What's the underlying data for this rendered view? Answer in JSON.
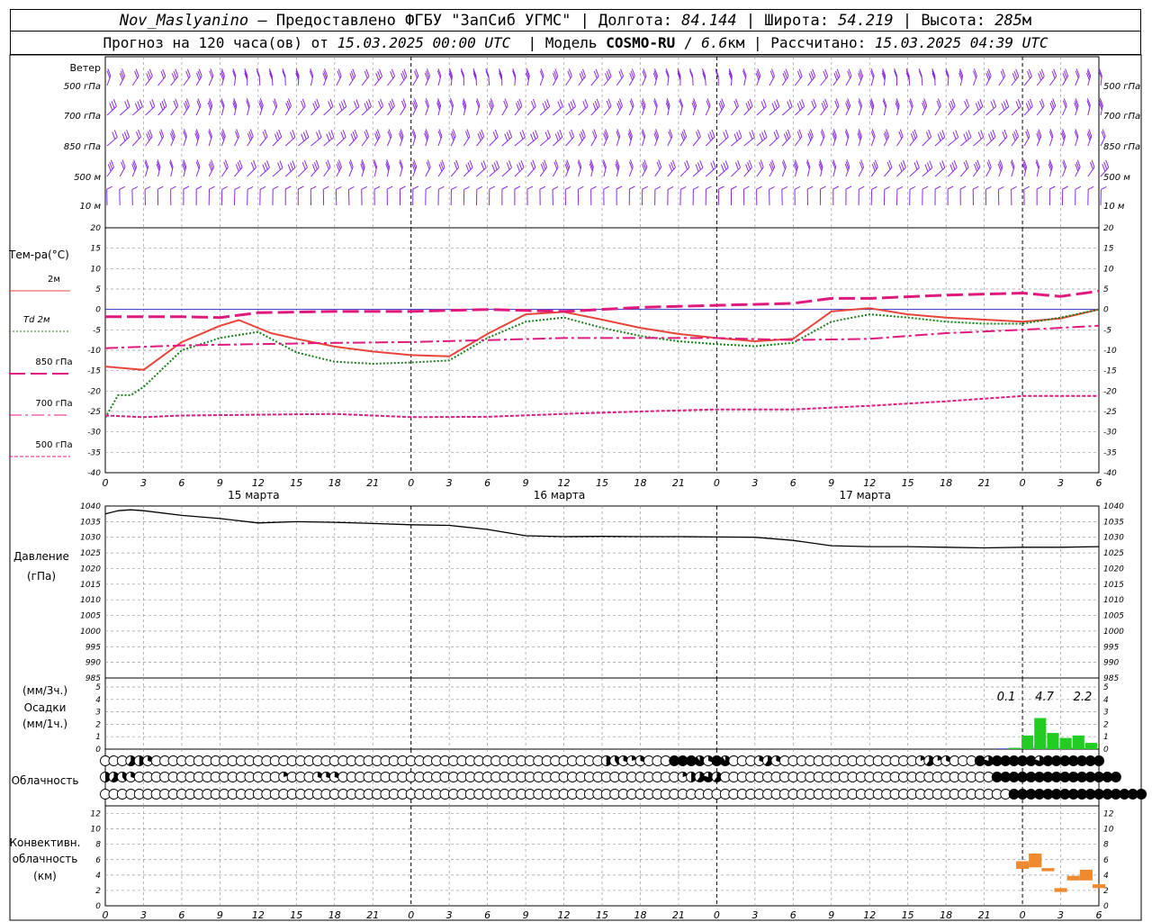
{
  "header": {
    "station": "Nov_Maslyanino",
    "sep1": " – Предоставлено ФГБУ \"ЗапСиб УГМС\" | Долгота: ",
    "lon": "84.144",
    "sep2": " | Широта: ",
    "lat": "54.219",
    "sep3": " | Высота: ",
    "alt": "285",
    "alt_unit": "м",
    "fc_prefix": "Прогноз на 120 часа(ов) от ",
    "fc_start": "15.03.2025 00:00 UTC",
    "model_prefix": "  | Модель ",
    "model": "COSMO-RU",
    "model_sep": " / ",
    "res": "6.6",
    "res_unit": "км",
    "calc_prefix": " | Рассчитано: ",
    "calc_time": "15.03.2025 04:39 UTC"
  },
  "colors": {
    "t2m": "#e8443a",
    "td2m": "#1a7f1a",
    "t850": "#e0197d",
    "t700": "#e0197d",
    "t500": "#e0197d",
    "wind": "#8a2be2",
    "zero_line": "#3333cc",
    "pressure": "#000000",
    "precip_3h": "#22cc22",
    "precip_1h": "#2233cc",
    "convective": "#f08a30",
    "grid": "#999999"
  },
  "x_axis": {
    "hours": [
      0,
      3,
      6,
      9,
      12,
      15,
      18,
      21,
      0,
      3,
      6,
      9,
      12,
      15,
      18,
      21,
      0,
      3,
      6,
      9,
      12,
      15,
      18,
      21,
      0,
      3,
      6
    ],
    "day_labels": [
      {
        "label": "15 марта",
        "hour": 12
      },
      {
        "label": "16 марта",
        "hour": 36
      },
      {
        "label": "17 марта",
        "hour": 60
      }
    ],
    "range": [
      0,
      78
    ]
  },
  "chart_data": [
    {
      "type": "wind_barbs",
      "title": "Ветер",
      "levels": [
        "500 гПа",
        "700 гПа",
        "850 гПа",
        "500 м",
        "10  м"
      ],
      "spacing_hours": 1
    },
    {
      "type": "line",
      "ylabel": "Тем-ра(°C)",
      "ylim": [
        -40,
        20
      ],
      "yticks": [
        20,
        15,
        10,
        5,
        0,
        -5,
        -10,
        -15,
        -20,
        -25,
        -30,
        -35,
        -40
      ],
      "series": [
        {
          "name": "2м",
          "key": "t2m",
          "dash": "",
          "x": [
            0,
            3,
            6,
            9,
            10.5,
            13,
            15,
            18,
            21,
            24,
            27,
            30,
            33,
            36,
            39,
            42,
            45,
            48,
            51,
            54,
            57,
            60,
            63,
            66,
            69,
            72,
            75,
            78
          ],
          "y": [
            -14,
            -14.8,
            -8,
            -4,
            -2.6,
            -5.8,
            -7.2,
            -9.1,
            -10.3,
            -11.2,
            -11.5,
            -6,
            -1.2,
            -0.6,
            -2.5,
            -4.5,
            -6,
            -7,
            -7.8,
            -7.2,
            -0.5,
            0.3,
            -1.2,
            -2,
            -2.5,
            -3,
            -2.2,
            0
          ]
        },
        {
          "name": "Td 2м",
          "key": "td2m",
          "dash": "2,2",
          "x": [
            0,
            1,
            2,
            3,
            6,
            9,
            12,
            15,
            18,
            21,
            24,
            27,
            30,
            33,
            36,
            39,
            42,
            45,
            48,
            51,
            54,
            57,
            60,
            63,
            66,
            69,
            72,
            75,
            78
          ],
          "y": [
            -26.5,
            -21,
            -21,
            -19,
            -10,
            -7,
            -5.5,
            -10.5,
            -12.8,
            -13.3,
            -13,
            -12.5,
            -7,
            -3,
            -2,
            -4.5,
            -6.5,
            -7.8,
            -8.5,
            -9,
            -8.2,
            -3,
            -1.2,
            -2,
            -3,
            -3.5,
            -3.5,
            -2,
            0
          ]
        },
        {
          "name": "850 гПа",
          "key": "t850",
          "dash": "18,6",
          "x": [
            0,
            6,
            9,
            12,
            18,
            24,
            30,
            36,
            42,
            48,
            54,
            57,
            60,
            66,
            72,
            75,
            78
          ],
          "y": [
            -1.8,
            -1.8,
            -2,
            -0.8,
            -0.5,
            -0.5,
            0,
            -0.5,
            0.5,
            1,
            1.5,
            2.7,
            2.7,
            3.5,
            4,
            3.2,
            4.5
          ]
        },
        {
          "name": "700 гПа",
          "key": "t700",
          "dash": "14,4,3,4",
          "x": [
            0,
            6,
            12,
            18,
            24,
            30,
            36,
            42,
            48,
            54,
            60,
            66,
            72,
            78
          ],
          "y": [
            -9.5,
            -8.8,
            -8.5,
            -8.2,
            -8,
            -7.5,
            -7,
            -7,
            -7,
            -7.5,
            -7.2,
            -5.8,
            -5,
            -4
          ]
        },
        {
          "name": "500 гПа",
          "key": "t500",
          "dash": "4,2",
          "x": [
            0,
            3,
            6,
            12,
            18,
            24,
            30,
            36,
            42,
            48,
            54,
            60,
            66,
            72,
            78
          ],
          "y": [
            -26,
            -26.4,
            -26,
            -25.8,
            -25.6,
            -26.4,
            -26.3,
            -25.6,
            -25,
            -24.5,
            -24.5,
            -23.6,
            -22.5,
            -21.2,
            -21.2
          ]
        }
      ]
    },
    {
      "type": "line",
      "ylabel": "Давление",
      "yunit": "(гПа)",
      "ylim": [
        985,
        1040
      ],
      "yticks": [
        1040,
        1035,
        1030,
        1025,
        1020,
        1015,
        1010,
        1005,
        1000,
        995,
        990,
        985
      ],
      "series": [
        {
          "key": "pressure",
          "x": [
            0,
            1,
            2,
            3,
            6,
            9,
            12,
            15,
            18,
            21,
            24,
            27,
            30,
            33,
            36,
            39,
            42,
            45,
            48,
            51,
            54,
            57,
            60,
            63,
            66,
            69,
            72,
            75,
            78
          ],
          "y": [
            1037.5,
            1038.5,
            1038.8,
            1038.5,
            1037,
            1036,
            1034.6,
            1035,
            1034.8,
            1034.4,
            1034,
            1033.8,
            1032.5,
            1030.5,
            1030.2,
            1030.3,
            1030.2,
            1030.2,
            1030.1,
            1030,
            1029,
            1027.3,
            1027,
            1027,
            1026.8,
            1026.6,
            1026.8,
            1026.8,
            1027
          ]
        }
      ]
    },
    {
      "type": "bar",
      "ylabel": "Осадки",
      "yunit_top": "(мм/3ч.)",
      "yunit_bottom": "(мм/1ч.)",
      "ylim": [
        0,
        5
      ],
      "yticks": [
        5,
        4,
        3,
        2,
        1,
        0
      ],
      "totals": [
        {
          "hour": 72,
          "label": "0.1"
        },
        {
          "hour": 75,
          "label": "4.7"
        },
        {
          "hour": 78,
          "label": "2.2"
        }
      ],
      "series": [
        {
          "name": "мм/1ч.",
          "key": "precip_1h",
          "x": [
            70,
            71,
            72,
            73,
            74,
            75,
            76,
            77
          ],
          "values": [
            0.05,
            0.1,
            0.2,
            0.3,
            0.15,
            0.2,
            0.15,
            0.1
          ]
        },
        {
          "name": "мм/3ч.",
          "key": "precip_3h",
          "x": [
            71,
            72,
            73,
            74,
            75,
            76,
            77
          ],
          "values": [
            0.1,
            1.1,
            2.5,
            1.3,
            0.9,
            1.1,
            0.5
          ]
        }
      ]
    },
    {
      "type": "table",
      "ylabel": "Облачность",
      "rows": [
        {
          "name": "high",
          "values": [
            0,
            0,
            0,
            0.6,
            0.5,
            0.3,
            0,
            0,
            0,
            0,
            0,
            0,
            0,
            0,
            0,
            0,
            0,
            0,
            0,
            0,
            0,
            0,
            0,
            0,
            0,
            0,
            0,
            0,
            0,
            0,
            0,
            0,
            0,
            0,
            0,
            0,
            0,
            0,
            0,
            0,
            0,
            0,
            0,
            0,
            0,
            0,
            0,
            0,
            0,
            0,
            0,
            0,
            0,
            0,
            0,
            0,
            0,
            0,
            0,
            0.5,
            0.4,
            0.3,
            0.2,
            0.3,
            0,
            0,
            0,
            1,
            1,
            1,
            0.9,
            0.3,
            1,
            0.9,
            0,
            0,
            0,
            0.3,
            0.6,
            0.3,
            0,
            0,
            0,
            0,
            0,
            0,
            0,
            0,
            0,
            0,
            0,
            0,
            0,
            0,
            0,
            0,
            0.2,
            0.6,
            0.2,
            0.3,
            0,
            0,
            0,
            1,
            0.8,
            1,
            1,
            1,
            1,
            1,
            0.8,
            1,
            1,
            1,
            1,
            1,
            1,
            1
          ]
        },
        {
          "name": "middle",
          "values": [
            0.5,
            0.6,
            0.4,
            0.3,
            0,
            0,
            0,
            0,
            0,
            0,
            0,
            0,
            0,
            0,
            0,
            0,
            0,
            0,
            0,
            0,
            0,
            0.2,
            0,
            0,
            0,
            0.3,
            0.3,
            0.3,
            0,
            0,
            0,
            0,
            0,
            0,
            0,
            0,
            0,
            0,
            0,
            0,
            0,
            0,
            0,
            0,
            0,
            0,
            0,
            0,
            0,
            0,
            0,
            0,
            0,
            0,
            0,
            0,
            0,
            0,
            0,
            0,
            0,
            0,
            0,
            0,
            0,
            0,
            0,
            0,
            0.2,
            0.5,
            0.6,
            0.8,
            0.6,
            0,
            0,
            0,
            0,
            0,
            0,
            0,
            0,
            0,
            0,
            0,
            0,
            0,
            0,
            0,
            0,
            0,
            0,
            0,
            0,
            0,
            0,
            0,
            0,
            0,
            0,
            0,
            0,
            0,
            0,
            0,
            0,
            1,
            1,
            1,
            1,
            1,
            1,
            1,
            1,
            1,
            1,
            1,
            1,
            1,
            1,
            1
          ]
        },
        {
          "name": "low",
          "values": [
            0,
            0,
            0,
            0,
            0,
            0,
            0,
            0,
            0,
            0,
            0,
            0,
            0,
            0,
            0,
            0,
            0,
            0,
            0,
            0,
            0,
            0,
            0,
            0,
            0,
            0,
            0,
            0,
            0,
            0,
            0,
            0,
            0,
            0,
            0,
            0,
            0,
            0,
            0,
            0,
            0,
            0,
            0,
            0,
            0,
            0,
            0,
            0,
            0,
            0,
            0,
            0,
            0,
            0,
            0,
            0,
            0,
            0,
            0,
            0,
            0,
            0,
            0,
            0,
            0,
            0,
            0,
            0,
            0,
            0,
            0,
            0,
            0,
            0,
            0,
            0,
            0,
            0,
            0,
            0,
            0,
            0,
            0,
            0,
            0,
            0,
            0,
            0,
            0,
            0,
            0,
            0,
            0,
            0,
            0,
            0,
            0,
            0,
            0,
            0,
            0,
            0,
            0,
            0,
            0,
            0,
            0,
            1,
            1,
            1,
            1,
            1,
            1,
            1,
            1,
            1,
            1,
            1,
            1,
            1,
            1,
            1,
            1
          ]
        }
      ]
    },
    {
      "type": "bar",
      "ylabel": "Конвективн.",
      "ylabel2": "облачность",
      "yunit": "(км)",
      "ylim": [
        0,
        13
      ],
      "yticks": [
        12,
        10,
        8,
        6,
        4,
        2,
        0
      ],
      "series": [
        {
          "key": "convective",
          "x": [
            72,
            73,
            74,
            75,
            76,
            77,
            78
          ],
          "lo": [
            4.8,
            5,
            4.5,
            1.8,
            3.3,
            3.3,
            2.3
          ],
          "hi": [
            5.8,
            6.8,
            4.9,
            2.3,
            3.9,
            4.7,
            2.8
          ]
        }
      ]
    }
  ]
}
